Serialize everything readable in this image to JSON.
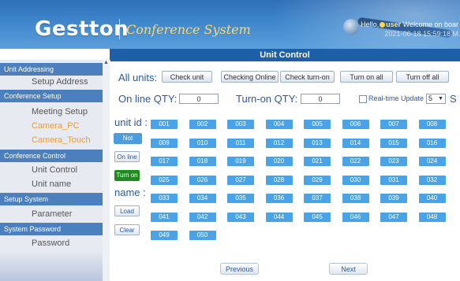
{
  "header": {
    "logo": "Gestton",
    "subtitle": "Conference System",
    "greeting": "Hello,",
    "username": "user",
    "welcome": "Welcome on boar",
    "timestamp": "2021-06-18 15:59:18 M"
  },
  "title_bar": "Unit Control",
  "sidebar": {
    "sections": [
      {
        "header": "Unit Addressing",
        "items": [
          {
            "label": "Setup Address",
            "style": "normal"
          }
        ]
      },
      {
        "header": "Conference Setup",
        "items": [
          {
            "label": "Meeting Setup",
            "style": "normal"
          },
          {
            "label": "Camera_PC",
            "style": "orange"
          },
          {
            "label": "Camera_Touch",
            "style": "orange"
          }
        ]
      },
      {
        "header": "Conference Control",
        "items": [
          {
            "label": "Unit Control",
            "style": "normal"
          },
          {
            "label": "Unit name",
            "style": "normal"
          }
        ]
      },
      {
        "header": "Setup System",
        "items": [
          {
            "label": "Parameter",
            "style": "normal"
          }
        ]
      },
      {
        "header": "System Password",
        "items": [
          {
            "label": "Password",
            "style": "normal"
          }
        ]
      }
    ]
  },
  "controls": {
    "all_units_label": "All units:",
    "buttons": [
      "Check unit",
      "Checking Online",
      "Check turn-on",
      "Turn on all",
      "Turn off all"
    ],
    "online_qty_label": "On line QTY:",
    "online_qty_value": "0",
    "turnon_qty_label": "Turn-on QTY:",
    "turnon_qty_value": "0",
    "realtime_label": "Real-time Update",
    "realtime_value": "5",
    "seconds_label": "S"
  },
  "unit_panel": {
    "unit_id_label": "unit id :",
    "not_online": "Not online",
    "on_line": "On line",
    "turn_on": "Turn on",
    "name_label": "name :",
    "load": "Load",
    "clear": "Clear"
  },
  "units": [
    "001",
    "002",
    "003",
    "004",
    "005",
    "006",
    "007",
    "008",
    "009",
    "010",
    "011",
    "012",
    "013",
    "014",
    "015",
    "016",
    "017",
    "018",
    "019",
    "020",
    "021",
    "022",
    "023",
    "024",
    "025",
    "026",
    "027",
    "028",
    "029",
    "030",
    "031",
    "032",
    "033",
    "034",
    "035",
    "036",
    "037",
    "038",
    "039",
    "040",
    "041",
    "042",
    "043",
    "044",
    "045",
    "046",
    "047",
    "048",
    "049",
    "050"
  ],
  "pager": {
    "previous": "Previous",
    "next": "Next"
  },
  "colors": {
    "unit_tile": "#4aa3e6",
    "header_blue": "#3e86cc",
    "title_bar": "#1d5fa8",
    "turn_on_green": "#1f8a1f",
    "orange_item": "#f09a30"
  }
}
